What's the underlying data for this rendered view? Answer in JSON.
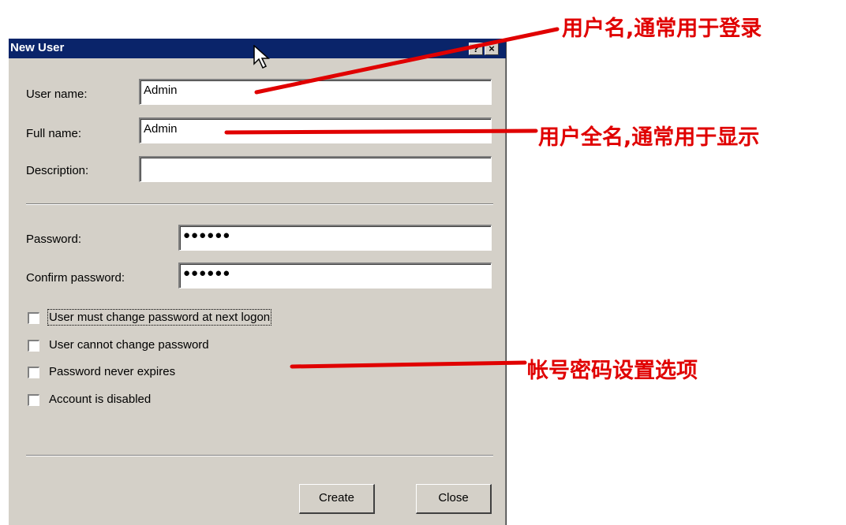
{
  "window": {
    "title": "New User",
    "help_button": "?",
    "close_button": "×"
  },
  "fields": {
    "username": {
      "label": "User name:",
      "value": "Admin"
    },
    "fullname": {
      "label": "Full name:",
      "value": "Admin"
    },
    "description": {
      "label": "Description:",
      "value": ""
    },
    "password": {
      "label": "Password:",
      "value": "●●●●●●"
    },
    "confirm": {
      "label": "Confirm password:",
      "value": "●●●●●●"
    }
  },
  "options": [
    {
      "label": "User must change password at next logon",
      "checked": false
    },
    {
      "label": "User cannot change password",
      "checked": false
    },
    {
      "label": "Password never expires",
      "checked": false
    },
    {
      "label": "Account is disabled",
      "checked": false
    }
  ],
  "buttons": {
    "create": "Create",
    "close": "Close"
  },
  "annotations": {
    "username_note": "用户名,通常用于登录",
    "fullname_note": "用户全名,通常用于显示",
    "options_note": "帐号密码设置选项"
  },
  "colors": {
    "titlebar": "#0a246a",
    "dialog_bg": "#d4d0c8",
    "annotation": "#e00000"
  },
  "icons": {
    "cursor": "mouse-pointer-icon",
    "help": "help-icon",
    "close": "close-icon"
  }
}
